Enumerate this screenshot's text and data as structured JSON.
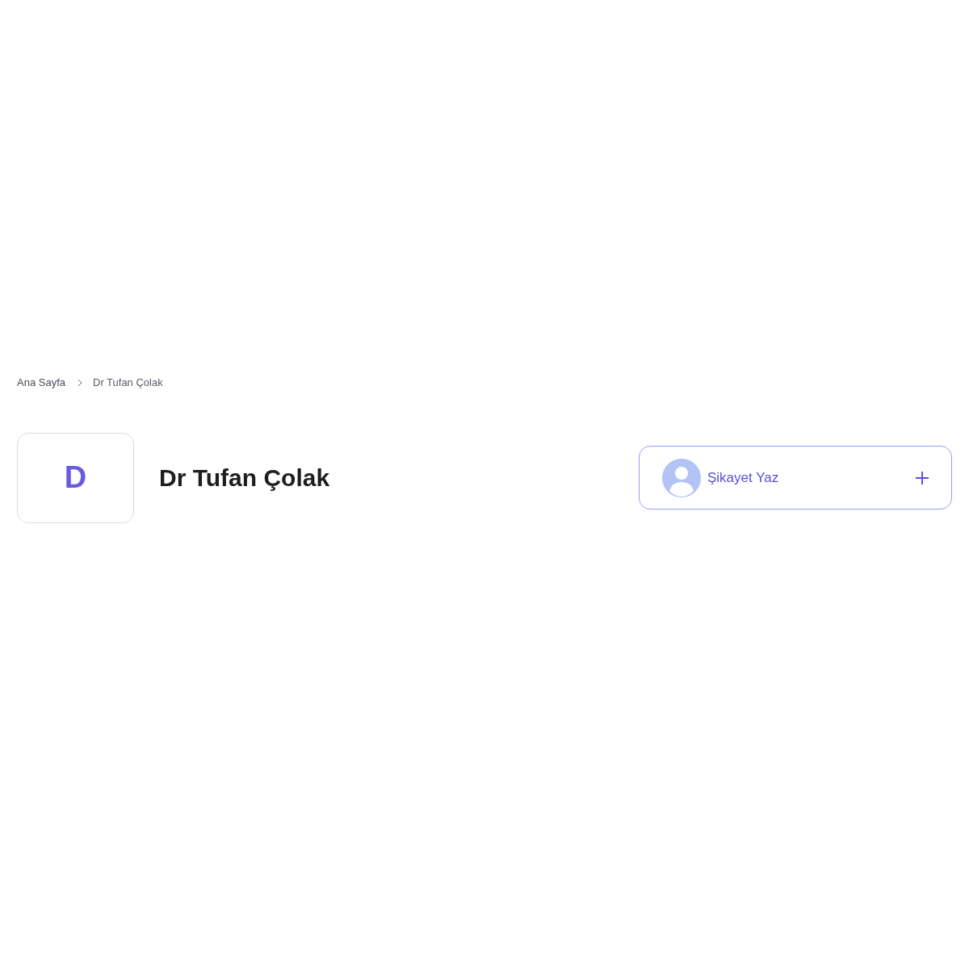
{
  "breadcrumb": [
    {
      "label": "Ana Sayfa"
    },
    {
      "label": "Dr Tufan Çolak"
    }
  ],
  "profile": {
    "initial": "D",
    "name": "Dr Tufan Çolak"
  },
  "complaint_button": {
    "label": "Şikayet Yaz"
  }
}
